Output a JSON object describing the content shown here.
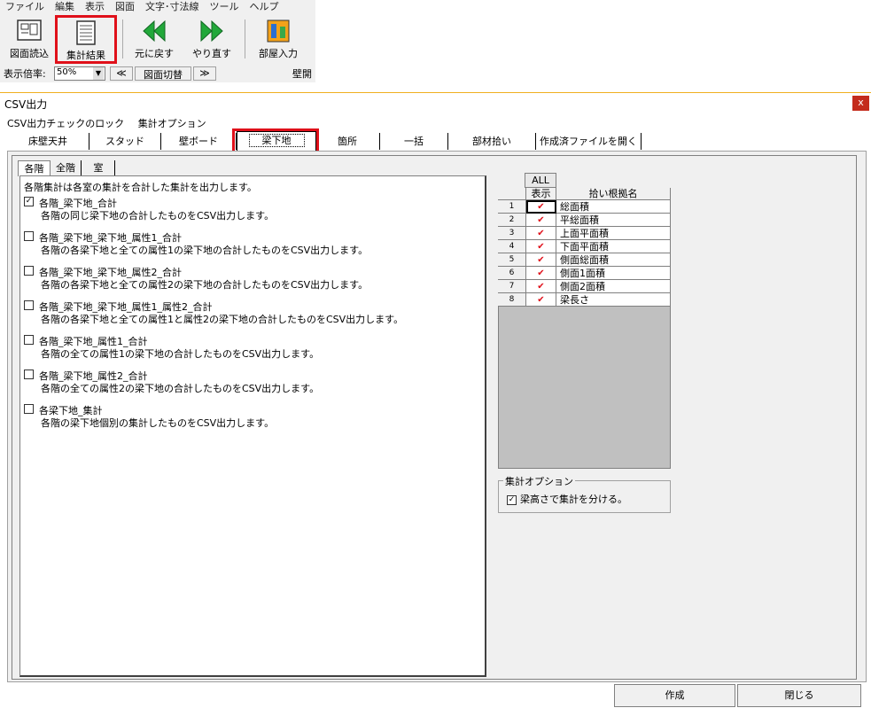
{
  "app": {
    "menu": [
      "ファイル",
      "編集",
      "表示",
      "図面",
      "文字･寸法線",
      "ツール",
      "ヘルプ"
    ],
    "toolbar": [
      {
        "label": "図面読込",
        "icon": "drawing-load-icon"
      },
      {
        "label": "集計結果",
        "icon": "tally-result-icon"
      },
      {
        "label": "元に戻す",
        "icon": "undo-icon"
      },
      {
        "label": "やり直す",
        "icon": "redo-icon"
      },
      {
        "label": "部屋入力",
        "icon": "room-input-icon"
      }
    ],
    "zoom_label": "表示倍率:",
    "zoom_value": "50%",
    "prev_label": "≪",
    "switch_label": "図面切替",
    "next_label": "≫",
    "wall_open_label": "壁開"
  },
  "dialog": {
    "title": "CSV出力",
    "close_label": "x",
    "menu": [
      "CSV出力チェックのロック",
      "集計オプション"
    ],
    "tabs": [
      "床壁天井",
      "スタッド",
      "壁ボード",
      "梁下地",
      "箇所",
      "一括",
      "部材拾い",
      "作成済ファイルを開く"
    ],
    "active_tab": "梁下地",
    "subtabs": [
      "各階",
      "全階",
      "室"
    ],
    "description": "各階集計は各室の集計を合計した集計を出力します。",
    "options": [
      {
        "checked": "✓",
        "label": "各階_梁下地_合計",
        "desc": "各階の同じ梁下地の合計したものをCSV出力します。"
      },
      {
        "checked": "",
        "label": "各階_梁下地_梁下地_属性1_合計",
        "desc": "各階の各梁下地と全ての属性1の梁下地の合計したものをCSV出力します。"
      },
      {
        "checked": "",
        "label": "各階_梁下地_梁下地_属性2_合計",
        "desc": "各階の各梁下地と全ての属性2の梁下地の合計したものをCSV出力します。"
      },
      {
        "checked": "",
        "label": "各階_梁下地_梁下地_属性1_属性2_合計",
        "desc": "各階の各梁下地と全ての属性1と属性2の梁下地の合計したものをCSV出力します。"
      },
      {
        "checked": "",
        "label": "各階_梁下地_属性1_合計",
        "desc": "各階の全ての属性1の梁下地の合計したものをCSV出力します。"
      },
      {
        "checked": "",
        "label": "各階_梁下地_属性2_合計",
        "desc": "各階の全ての属性2の梁下地の合計したものをCSV出力します。"
      },
      {
        "checked": "",
        "label": "各梁下地_集計",
        "desc": "各階の梁下地個別の集計したものをCSV出力します。"
      }
    ],
    "grid": {
      "all_label": "ALL",
      "col_show": "表示",
      "col_name": "拾い根拠名",
      "rows": [
        {
          "n": "1",
          "check": "✔",
          "name": "総面積"
        },
        {
          "n": "2",
          "check": "✔",
          "name": "平総面積"
        },
        {
          "n": "3",
          "check": "✔",
          "name": "上面平面積"
        },
        {
          "n": "4",
          "check": "✔",
          "name": "下面平面積"
        },
        {
          "n": "5",
          "check": "✔",
          "name": "側面総面積"
        },
        {
          "n": "6",
          "check": "✔",
          "name": "側面1面積"
        },
        {
          "n": "7",
          "check": "✔",
          "name": "側面2面積"
        },
        {
          "n": "8",
          "check": "✔",
          "name": "梁長さ"
        }
      ]
    },
    "option_group": {
      "title": "集計オプション",
      "checked": "✓",
      "label": "梁高さで集計を分ける。"
    },
    "buttons": {
      "create": "作成",
      "close": "閉じる"
    }
  }
}
